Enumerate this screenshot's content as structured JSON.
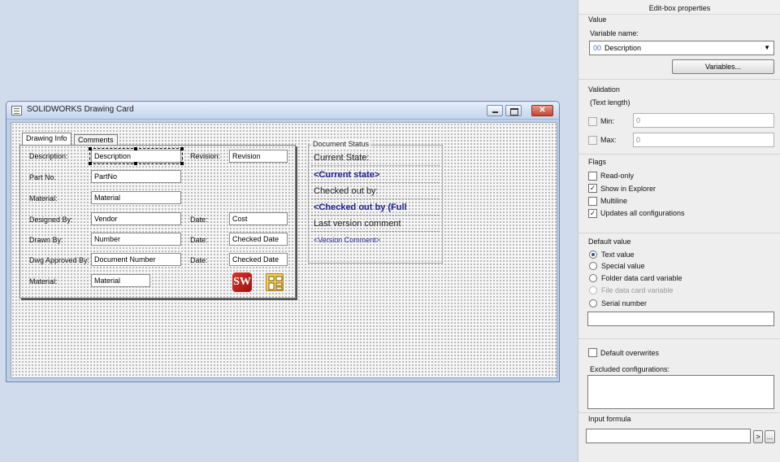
{
  "card_window": {
    "title": "SOLIDWORKS Drawing Card",
    "tabs": [
      {
        "label": "Drawing Info"
      },
      {
        "label": "Comments"
      }
    ],
    "form": {
      "description_label": "Description:",
      "description_value": "Description",
      "revision_label": "Revision:",
      "revision_value": "Revision",
      "partno_label": "Part No.",
      "partno_value": "PartNo",
      "material_label": "Material:",
      "material_value": "Material",
      "designedby_label": "Designed By:",
      "designedby_value": "Vendor",
      "date1_label": "Date:",
      "date1_value": "Cost",
      "drawnby_label": "Drawn By:",
      "drawnby_value": "Number",
      "date2_label": "Date:",
      "date2_value": "Checked Date",
      "dwgapproved_label": "Dwg Approved By:",
      "dwgapproved_value": "Document Number",
      "date3_label": "Date:",
      "date3_value": "Checked Date",
      "material2_label": "Material:",
      "material2_value": "Material",
      "sw_logo_text": "SW"
    },
    "document_status": {
      "caption": "Document Status",
      "current_state_label": "Current State:",
      "current_state_value": "<Current state>",
      "checked_out_label": "Checked out by:",
      "checked_out_value": "<Checked out by (Full",
      "last_comment_label": "Last version comment",
      "version_comment_value": "<Version Comment>"
    }
  },
  "properties_panel": {
    "title": "Edit-box properties",
    "value_section": {
      "heading": "Value",
      "variable_name_label": "Variable name:",
      "variable_icon_text": "00",
      "variable_selected": "Description",
      "variables_button": "Variables..."
    },
    "validation": {
      "heading": "Validation",
      "sub_heading": "(Text length)",
      "min_label": "Min:",
      "min_value": "0",
      "min_checked": false,
      "max_label": "Max:",
      "max_value": "0",
      "max_checked": false
    },
    "flags": {
      "heading": "Flags",
      "items": [
        {
          "label": "Read-only",
          "checked": false
        },
        {
          "label": "Show in Explorer",
          "checked": true
        },
        {
          "label": "Multiline",
          "checked": false
        },
        {
          "label": "Updates all configurations",
          "checked": true
        }
      ]
    },
    "default_value": {
      "heading": "Default value",
      "options": [
        {
          "label": "Text value",
          "selected": true,
          "enabled": true
        },
        {
          "label": "Special value",
          "selected": false,
          "enabled": true
        },
        {
          "label": "Folder data card variable",
          "selected": false,
          "enabled": true
        },
        {
          "label": "File data card variable",
          "selected": false,
          "enabled": false
        },
        {
          "label": "Serial number",
          "selected": false,
          "enabled": true
        }
      ],
      "text_input_value": ""
    },
    "overwrites": {
      "default_overwrites_label": "Default overwrites",
      "default_overwrites_checked": false,
      "excluded_configs_label": "Excluded configurations:",
      "excluded_configs_value": ""
    },
    "input_formula": {
      "heading": "Input formula",
      "value": "",
      "arrow_button": ">",
      "more_button": "..."
    }
  }
}
